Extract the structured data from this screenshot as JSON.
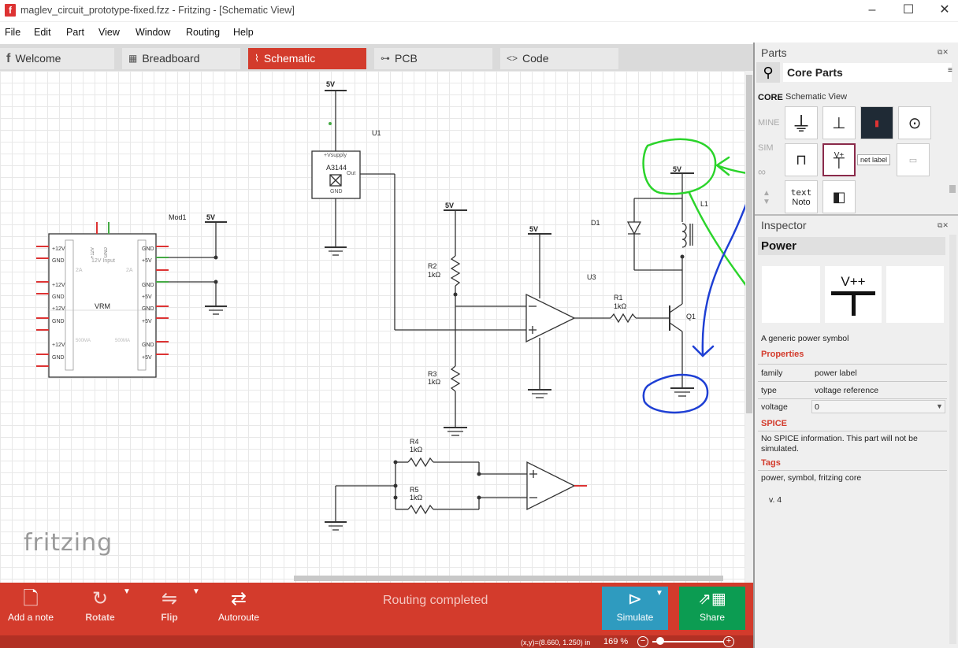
{
  "window": {
    "title": "maglev_circuit_prototype-fixed.fzz - Fritzing - [Schematic View]",
    "app_icon": "f"
  },
  "menu": [
    "File",
    "Edit",
    "Part",
    "View",
    "Window",
    "Routing",
    "Help"
  ],
  "tabs": [
    {
      "label": "Welcome",
      "icon": "f"
    },
    {
      "label": "Breadboard",
      "icon": "▦"
    },
    {
      "label": "Schematic",
      "icon": "⌇"
    },
    {
      "label": "PCB",
      "icon": "⊶"
    },
    {
      "label": "Code",
      "icon": "<>"
    }
  ],
  "schematic": {
    "labels": {
      "u1": "U1",
      "u1_part": "A3144",
      "u1_vsupply": "+Vsupply",
      "u1_out": "Out",
      "u1_gnd": "GND",
      "mod1": "Mod1",
      "vrm": "VRM",
      "vrm_input": "12V Input",
      "vrm_12v": "+12V",
      "vrm_gnd_top": "GND",
      "vrm_2a": "2A",
      "vrm_500ma": "500MA",
      "pins_left": [
        "+12V",
        "GND",
        "+12V",
        "GND",
        "+12V",
        "GND",
        "+12V",
        "GND"
      ],
      "pins_right": [
        "GND",
        "+5V",
        "GND",
        "+5V",
        "GND",
        "+5V",
        "GND",
        "+5V"
      ],
      "five_v": "5V",
      "r1": "R1",
      "r2": "R2",
      "r3": "R3",
      "r4": "R4",
      "r5": "R5",
      "kohm": "1kΩ",
      "d1": "D1",
      "l1": "L1",
      "q1": "Q1",
      "u3": "U3"
    }
  },
  "logo": "fritzing",
  "toolbar": {
    "add_note": "Add a note",
    "rotate": "Rotate",
    "flip": "Flip",
    "autoroute": "Autoroute",
    "status": "Routing completed",
    "simulate": "Simulate",
    "share": "Share"
  },
  "statusbar": {
    "coords": "(x,y)=(8.660, 1.250) in",
    "zoom": "169 %"
  },
  "parts": {
    "title": "Parts",
    "bin": "Core Parts",
    "view": "Schematic View",
    "bins": [
      "CORE",
      "MINE",
      "SIM",
      "∞"
    ],
    "tile_labels": {
      "vpp": "V+",
      "net": "net label",
      "text": "text",
      "noto": "Noto"
    }
  },
  "inspector": {
    "title": "Inspector",
    "part_title": "Power",
    "vpp": "V++",
    "description": "A generic power symbol",
    "properties_head": "Properties",
    "props": [
      {
        "name": "family",
        "value": "power label"
      },
      {
        "name": "type",
        "value": "voltage reference"
      },
      {
        "name": "voltage",
        "value": "0"
      }
    ],
    "spice_head": "SPICE",
    "spice_text": "No SPICE information. This part will not be simulated.",
    "tags_head": "Tags",
    "tags": "power, symbol, fritzing core",
    "version": "v. 4"
  }
}
